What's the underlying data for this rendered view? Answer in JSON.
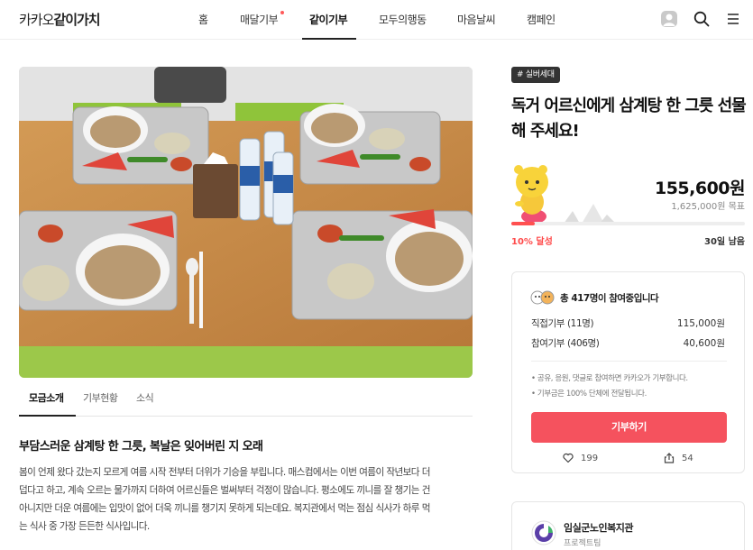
{
  "header": {
    "logo_prefix": "카카오",
    "logo_bold": "같이가치",
    "nav": [
      "홈",
      "매달기부",
      "같이기부",
      "모두의행동",
      "마음날씨",
      "캠페인"
    ],
    "active_nav": "같이기부"
  },
  "tabs": [
    "모금소개",
    "기부현황",
    "소식"
  ],
  "story": {
    "title": "부담스러운 삼계탕 한 그릇, 복날은 잊어버린 지 오래",
    "lines": [
      "봄이 언제 왔다 갔는지 모르게 여름 시작 전부터 더위가 기승을 부립니다. 매스컴에서는 이번 여름이 작년보다 더",
      "덥다고 하고, 계속 오르는 물가까지 더하여 어르신들은 벌써부터 걱정이 많습니다. 평소에도 끼니를 잘 챙기는 건",
      "아니지만 더운 여름에는 입맛이 없어 더욱 끼니를 챙기지 못하게 되는데요. 복지관에서 먹는 점심 식사가 하루 먹",
      "는 식사 중 가장 든든한 식사입니다."
    ]
  },
  "campaign": {
    "tag": "# 실버세대",
    "title": "독거 어르신에게 삼계탕 한 그릇 선물해 주세요!",
    "raised": "155,600원",
    "goal": "1,625,000원 목표",
    "progress": 0.1,
    "percent_label": "10% 달성",
    "days_left": "30일 남음"
  },
  "donation": {
    "participants": "총 417명이 참여중입니다",
    "direct_label": "직접기부 (11명)",
    "direct_value": "115,000원",
    "join_label": "참여기부 (406명)",
    "join_value": "40,600원",
    "note1": "• 공유, 응원, 댓글로 참여하면 카카오가 기부합니다.",
    "note2": "• 기부금은 100% 단체에 전달됩니다.",
    "button": "기부하기",
    "likes": "199",
    "shares": "54"
  },
  "org": {
    "name": "임실군노인복지관",
    "sub": "프로젝트팀"
  },
  "colors": {
    "accent": "#f5525e",
    "progress": "#ff5050"
  }
}
